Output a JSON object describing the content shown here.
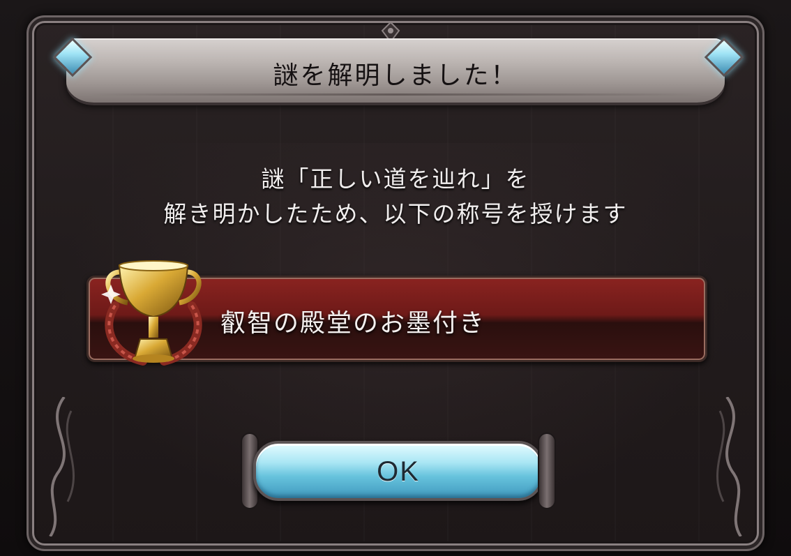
{
  "dialog": {
    "title": "謎を解明しました！",
    "message_line1": "謎「正しい道を辿れ」を",
    "message_line2": "解き明かしたため、以下の称号を授けます"
  },
  "reward": {
    "icon": "trophy-icon",
    "title_name": "叡智の殿堂のお墨付き"
  },
  "actions": {
    "ok_label": "OK"
  },
  "colors": {
    "banner": "#bdb6b3",
    "reward_bar": "#7a1e1b",
    "ok_button": "#8fd6ea",
    "gem": "#9fe3f5"
  }
}
